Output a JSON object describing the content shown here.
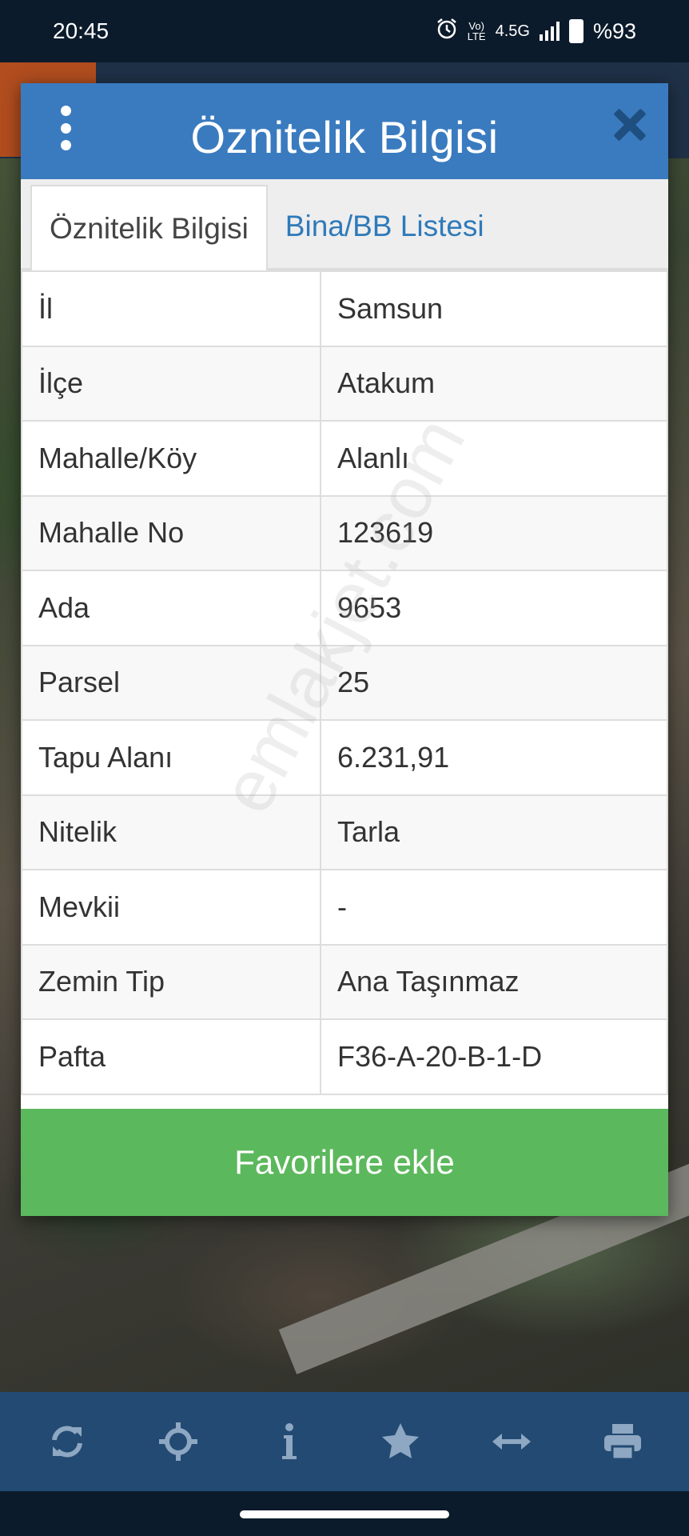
{
  "status_bar": {
    "time": "20:45",
    "network": "4.5G",
    "battery": "%93",
    "icons": [
      "alarm-icon",
      "volte-icon",
      "signal-icon",
      "battery-icon"
    ]
  },
  "dialog": {
    "title": "Öznitelik Bilgisi",
    "tabs": [
      {
        "label": "Öznitelik Bilgisi",
        "active": true
      },
      {
        "label": "Bina/BB Listesi",
        "active": false
      }
    ],
    "rows": [
      {
        "key": "İl",
        "value": "Samsun"
      },
      {
        "key": "İlçe",
        "value": "Atakum"
      },
      {
        "key": "Mahalle/Köy",
        "value": "Alanlı"
      },
      {
        "key": "Mahalle No",
        "value": "123619"
      },
      {
        "key": "Ada",
        "value": "9653"
      },
      {
        "key": "Parsel",
        "value": "25"
      },
      {
        "key": "Tapu Alanı",
        "value": "6.231,91"
      },
      {
        "key": "Nitelik",
        "value": "Tarla"
      },
      {
        "key": "Mevkii",
        "value": "-"
      },
      {
        "key": "Zemin Tip",
        "value": "Ana Taşınmaz"
      },
      {
        "key": "Pafta",
        "value": "F36-A-20-B-1-D"
      }
    ],
    "favorite_label": "Favorilere ekle",
    "watermark": "emlakjet.com"
  },
  "toolbar": {
    "items": [
      "refresh-icon",
      "locate-icon",
      "info-icon",
      "star-icon",
      "measure-icon",
      "print-icon"
    ]
  },
  "colors": {
    "header": "#3a7bbf",
    "tab_link": "#2f7ab9",
    "favorite": "#5cb85c",
    "toolbar": "#234a72",
    "toolbar_icon": "#8ea7c2"
  }
}
